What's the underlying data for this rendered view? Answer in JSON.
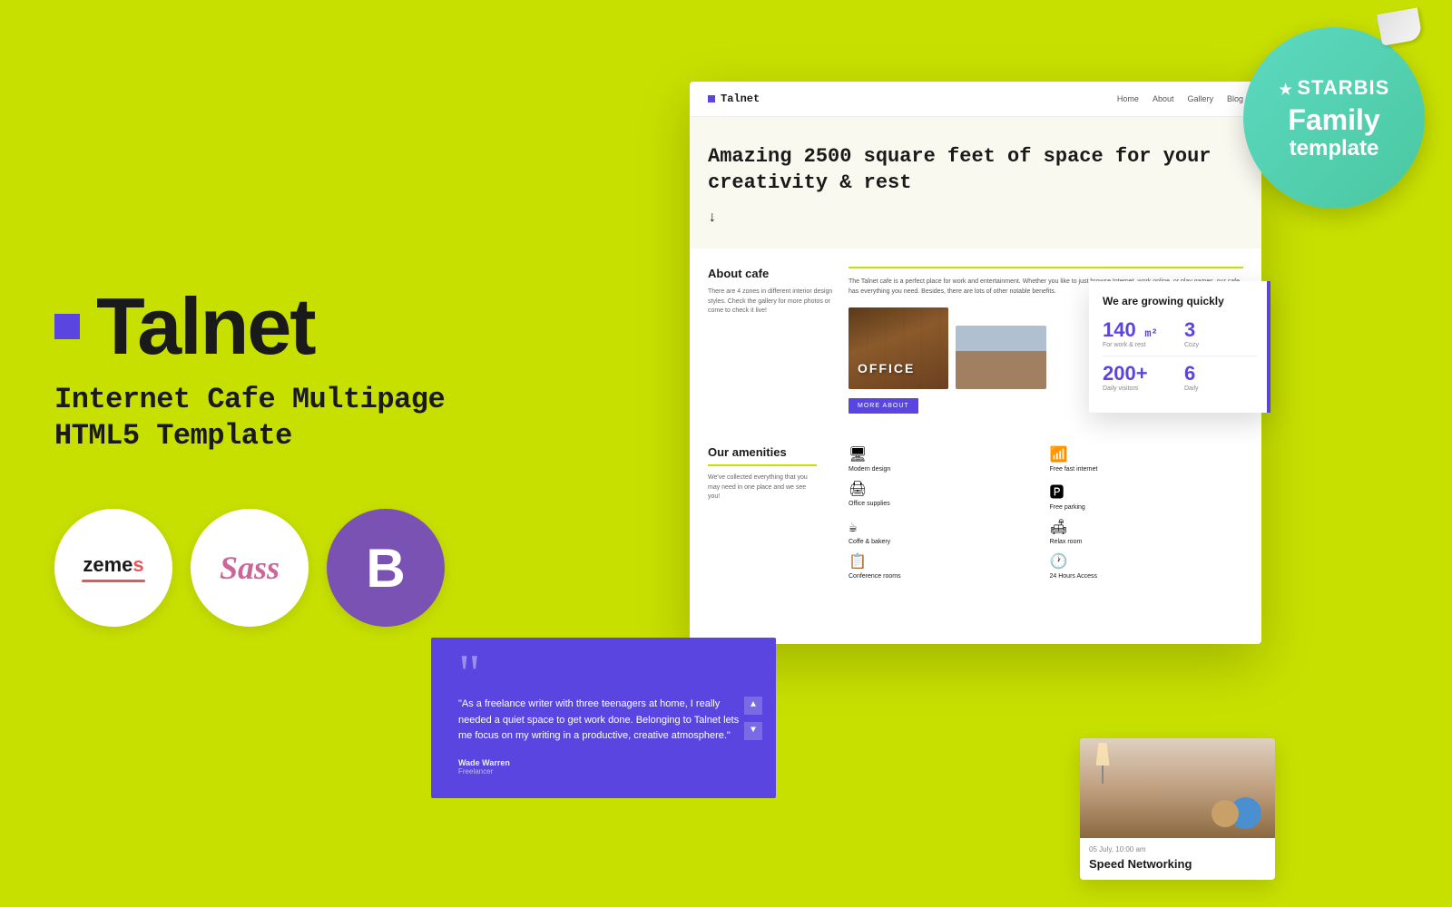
{
  "background": {
    "color": "#c8e000"
  },
  "brand": {
    "square_color": "#5b45e0",
    "title": "Talnet",
    "subtitle_line1": "Internet Cafe Multipage",
    "subtitle_line2": "HTML5 Template"
  },
  "tech_logos": [
    {
      "name": "Zemes",
      "type": "zemes"
    },
    {
      "name": "Sass",
      "type": "sass"
    },
    {
      "name": "Bootstrap",
      "type": "bootstrap"
    }
  ],
  "starbis_badge": {
    "star": "★",
    "brand": "STARBIS",
    "line1": "Family",
    "line2": "template"
  },
  "website_preview": {
    "nav": {
      "logo_square": "■",
      "logo_text": "Talnet",
      "links": [
        "Home",
        "About",
        "Gallery",
        "Blog"
      ]
    },
    "hero": {
      "title": "Amazing 2500 square feet of space for your creativity & rest",
      "arrow": "↓"
    },
    "about": {
      "title": "About cafe",
      "left_text": "There are 4 zones in different interior design styles. Check the gallery for more photos or come to check it live!",
      "right_text": "The Talnet cafe is a perfect place for work and entertainment. Whether you like to just browse Internet, work online, or play games, our cafe has everything you need. Besides, there are lots of other notable benefits.",
      "office_label": "OFFICE",
      "more_btn": "MORE ABOUT"
    },
    "amenities": {
      "title": "Our amenities",
      "description": "We've collected everything that you may need in one place and we see you!",
      "items": [
        {
          "icon": "🖥",
          "label": "Modern design"
        },
        {
          "icon": "📶",
          "label": "Free fast internet"
        },
        {
          "icon": "🖨",
          "label": "Office supplies"
        },
        {
          "icon": "🅿",
          "label": "Free parking"
        },
        {
          "icon": "☕",
          "label": "Coffe & bakery"
        },
        {
          "icon": "🛋",
          "label": "Relax room"
        },
        {
          "icon": "📋",
          "label": "Conference rooms"
        },
        {
          "icon": "🕐",
          "label": "24 Hours Access"
        }
      ]
    }
  },
  "stats": {
    "title": "We are growing quickly",
    "items": [
      {
        "value": "140",
        "unit": "m²",
        "label": "For work & rest"
      },
      {
        "value": "3",
        "unit": "",
        "label": "Cozy"
      },
      {
        "value": "200+",
        "unit": "",
        "label": "Daily visitors"
      },
      {
        "value": "6",
        "unit": "",
        "label": "Daily"
      }
    ]
  },
  "testimonial": {
    "quote": "\"As a freelance writer with three teenagers at home, I really needed a quiet space to get work done. Belonging to Talnet lets me focus on my writing in a productive, creative atmosphere.\"",
    "author": "Wade Warren, Freelancer",
    "arrows": [
      "▲",
      "▼"
    ]
  },
  "networking": {
    "date": "05 July, 10:00 am",
    "title": "Speed Networking"
  }
}
